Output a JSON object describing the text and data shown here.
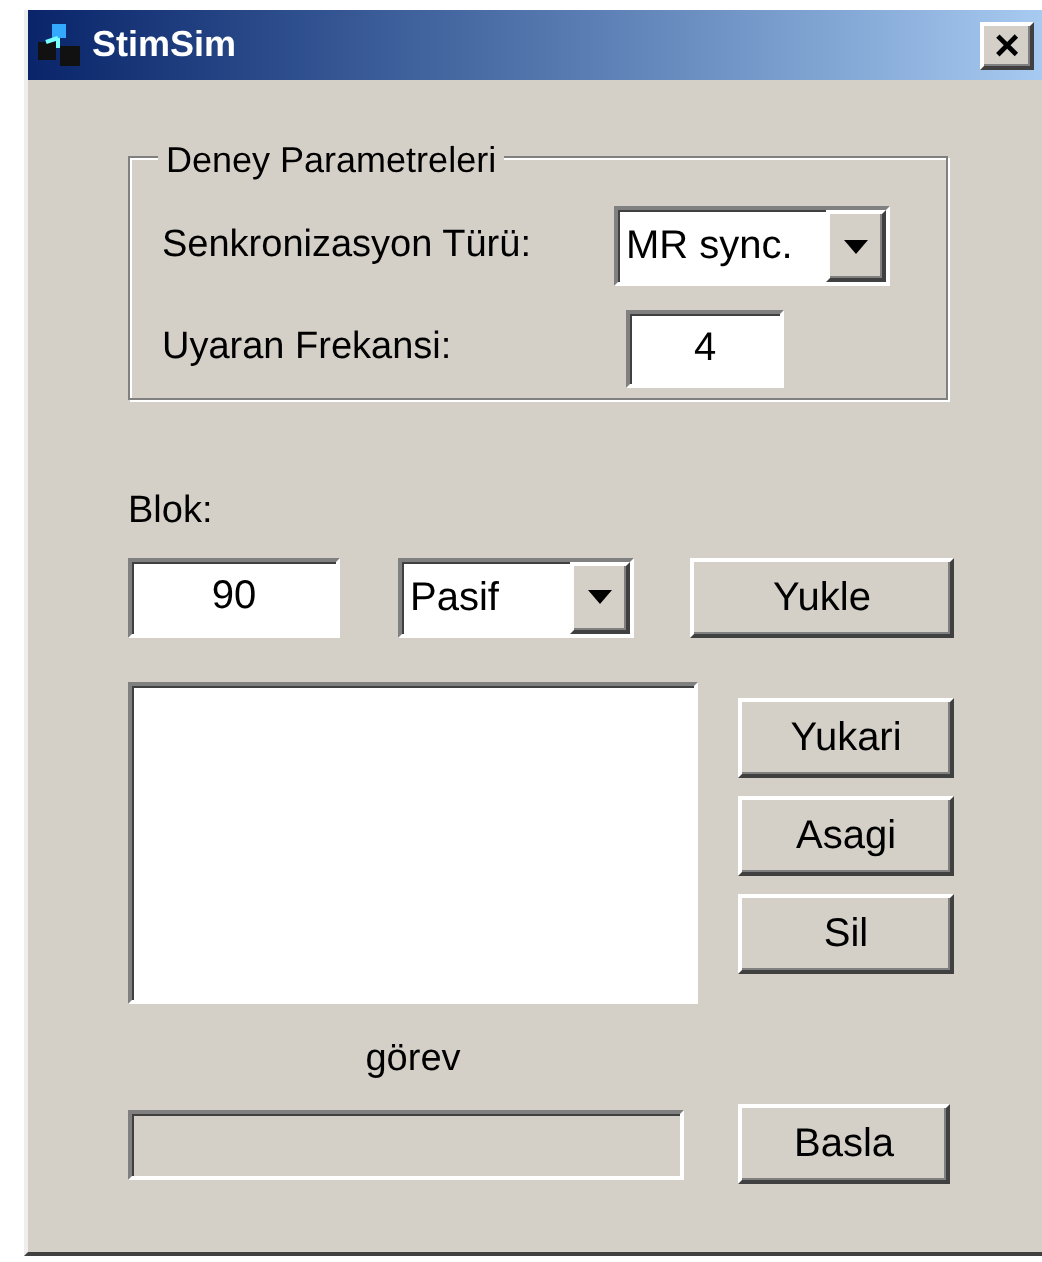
{
  "window": {
    "title": "StimSim",
    "close": "×"
  },
  "group": {
    "legend": "Deney Parametreleri",
    "sync": {
      "label": "Senkronizasyon Türü:",
      "value": "MR sync."
    },
    "freq": {
      "label": "Uyaran Frekansi:",
      "value": "4"
    }
  },
  "block": {
    "label": "Blok:",
    "value": "90",
    "mode": "Pasif",
    "load": "Yukle"
  },
  "list_buttons": [
    "Yukari",
    "Asagi",
    "Sil"
  ],
  "task": {
    "label": "görev",
    "level": 0,
    "start": "Basla"
  }
}
